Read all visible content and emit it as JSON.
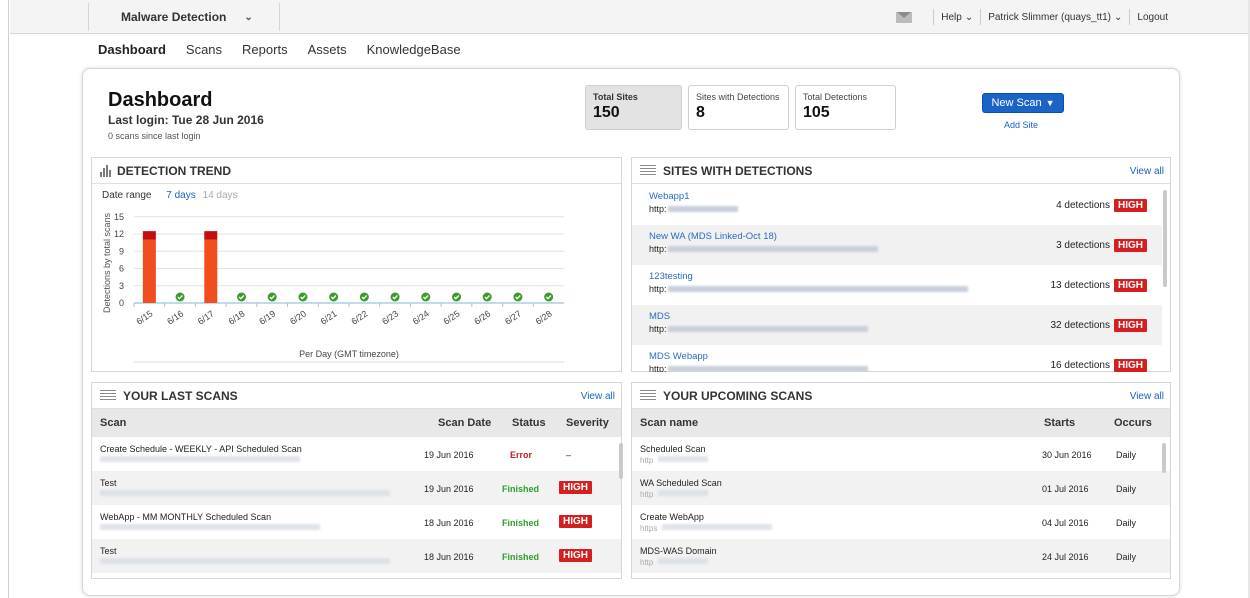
{
  "topbar": {
    "module": "Malware Detection",
    "help": "Help",
    "user": "Patrick Slimmer (quays_tt1)",
    "logout": "Logout"
  },
  "nav": [
    "Dashboard",
    "Scans",
    "Reports",
    "Assets",
    "KnowledgeBase"
  ],
  "dashboard": {
    "title": "Dashboard",
    "last_login": "Last login: Tue 28 Jun 2016",
    "since": "0 scans since last login",
    "stats": [
      {
        "label": "Total Sites",
        "value": "150"
      },
      {
        "label": "Sites with Detections",
        "value": "8"
      },
      {
        "label": "Total Detections",
        "value": "105"
      }
    ],
    "new_scan": "New Scan",
    "add_site": "Add Site"
  },
  "trend": {
    "title": "DETECTION TREND",
    "date_range_label": "Date range",
    "range_7": "7 days",
    "range_14": "14 days",
    "ylabel": "Detections by total scans",
    "xlabel": "Per Day (GMT timezone)"
  },
  "chart_data": {
    "type": "bar",
    "title": "DETECTION TREND",
    "xlabel": "Per Day (GMT timezone)",
    "ylabel": "Detections by total scans",
    "categories": [
      "6/15",
      "6/16",
      "6/17",
      "6/18",
      "6/19",
      "6/20",
      "6/21",
      "6/22",
      "6/23",
      "6/24",
      "6/25",
      "6/26",
      "6/27",
      "6/28"
    ],
    "series": [
      {
        "values": [
          11,
          0,
          11,
          0,
          0,
          0,
          0,
          0,
          0,
          0,
          0,
          0,
          0,
          0
        ],
        "color": "#f04e1e"
      },
      {
        "values": [
          1.5,
          0,
          1.5,
          0,
          0,
          0,
          0,
          0,
          0,
          0,
          0,
          0,
          0,
          0
        ],
        "color": "#c40e0e"
      }
    ],
    "yticks": [
      0,
      3,
      6,
      9,
      12,
      15
    ],
    "ylim": [
      0,
      16
    ],
    "grid": true
  },
  "sites": {
    "title": "SITES WITH DETECTIONS",
    "view_all": "View all",
    "rows": [
      {
        "name": "Webapp1",
        "http": "http:",
        "detections": "4 detections",
        "severity": "HIGH"
      },
      {
        "name": "New WA (MDS Linked-Oct 18)",
        "http": "http:",
        "detections": "3 detections",
        "severity": "HIGH"
      },
      {
        "name": "123testing",
        "http": "http:",
        "detections": "13 detections",
        "severity": "HIGH"
      },
      {
        "name": "MDS",
        "http": "http:",
        "detections": "32 detections",
        "severity": "HIGH"
      },
      {
        "name": "MDS Webapp",
        "http": "http:",
        "detections": "16 detections",
        "severity": "HIGH"
      }
    ]
  },
  "last_scans": {
    "title": "YOUR LAST SCANS",
    "view_all": "View all",
    "headers": [
      "Scan",
      "Scan Date",
      "Status",
      "Severity"
    ],
    "rows": [
      {
        "name": "Create Schedule - WEEKLY - API Scheduled Scan",
        "date": "19 Jun 2016",
        "status": "Error",
        "severity": "–"
      },
      {
        "name": "Test",
        "date": "19 Jun 2016",
        "status": "Finished",
        "severity": "HIGH"
      },
      {
        "name": "WebApp - MM MONTHLY Scheduled Scan",
        "date": "18 Jun 2016",
        "status": "Finished",
        "severity": "HIGH"
      },
      {
        "name": "Test",
        "date": "18 Jun 2016",
        "status": "Finished",
        "severity": "HIGH"
      }
    ]
  },
  "upcoming": {
    "title": "YOUR UPCOMING SCANS",
    "view_all": "View all",
    "headers": [
      "Scan name",
      "Starts",
      "Occurs"
    ],
    "rows": [
      {
        "name": "Scheduled Scan",
        "url": "http",
        "starts": "30 Jun 2016",
        "occurs": "Daily"
      },
      {
        "name": "WA Scheduled Scan",
        "url": "http",
        "starts": "01 Jul 2016",
        "occurs": "Daily"
      },
      {
        "name": "Create WebApp",
        "url": "https",
        "starts": "04 Jul 2016",
        "occurs": "Daily"
      },
      {
        "name": "MDS-WAS Domain",
        "url": "http",
        "starts": "24 Jul 2016",
        "occurs": "Daily"
      }
    ]
  }
}
